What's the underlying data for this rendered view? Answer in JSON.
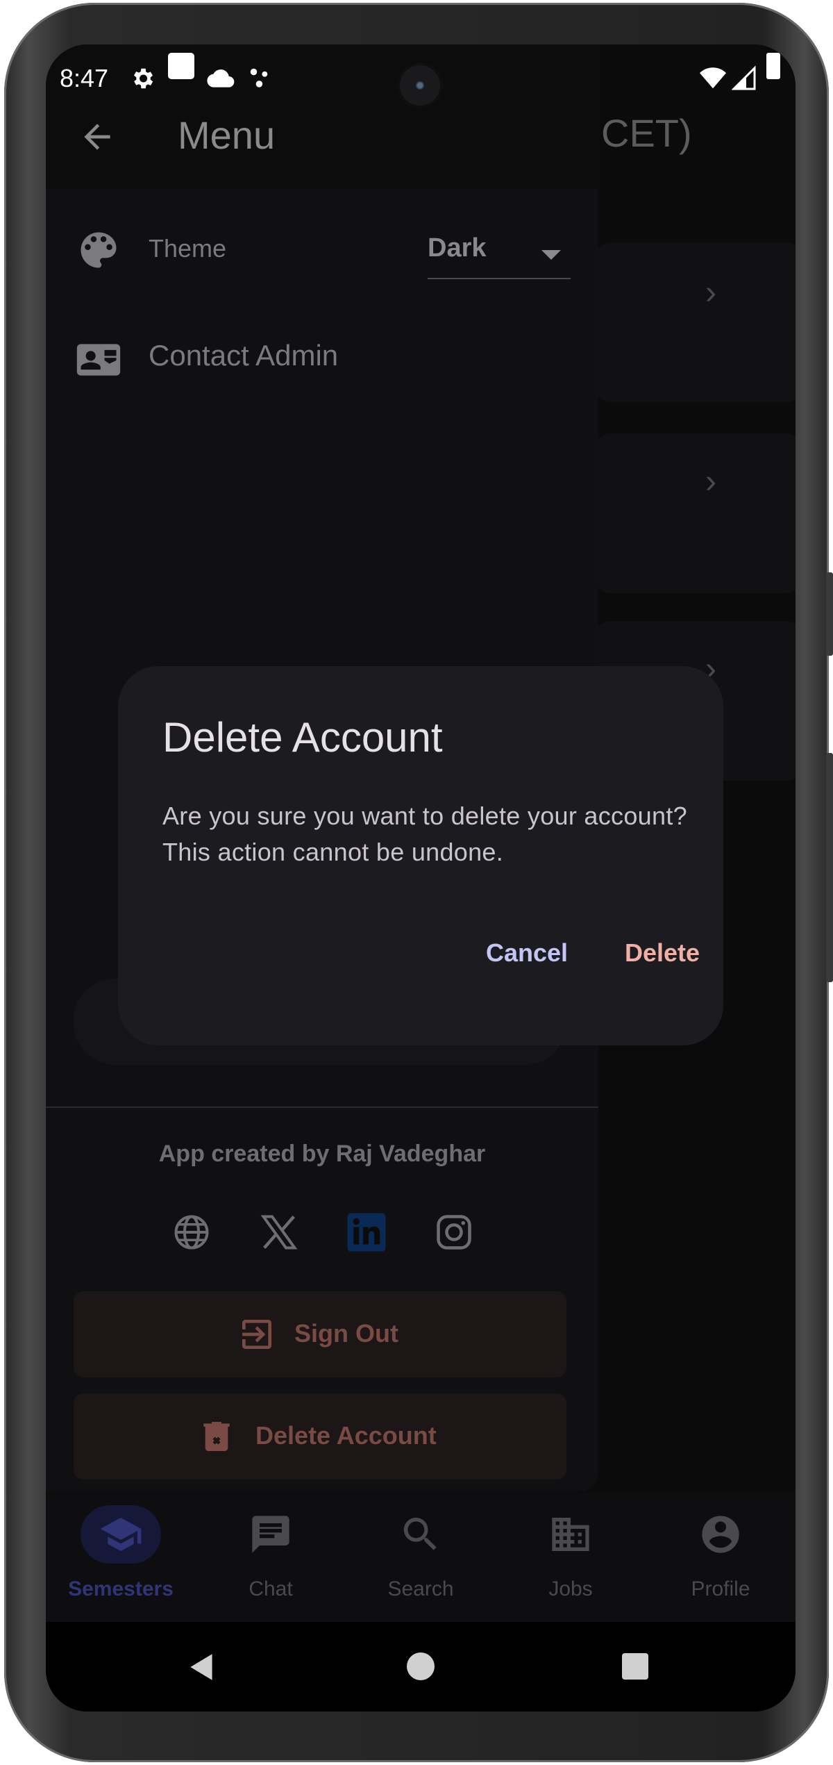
{
  "status_bar": {
    "time": "8:47",
    "icons": [
      "gear-icon",
      "square-notification-icon",
      "cloud-icon",
      "dots-icon",
      "wifi-icon",
      "signal-icon",
      "battery-icon"
    ]
  },
  "background_page": {
    "title_fragment": "CET)"
  },
  "drawer": {
    "title": "Menu",
    "theme_label": "Theme",
    "theme_value": "Dark",
    "contact_label": "Contact Admin",
    "credit": "App created by Raj Vadeghar",
    "social_icons": [
      "globe-icon",
      "x-icon",
      "linkedin-icon",
      "instagram-icon"
    ],
    "sign_out_label": "Sign Out",
    "delete_account_label": "Delete Account"
  },
  "bottom_nav": {
    "items": [
      {
        "label": "Semesters",
        "icon": "school-icon",
        "active": true
      },
      {
        "label": "Chat",
        "icon": "chat-icon",
        "active": false
      },
      {
        "label": "Search",
        "icon": "search-icon",
        "active": false
      },
      {
        "label": "Jobs",
        "icon": "business-icon",
        "active": false
      },
      {
        "label": "Profile",
        "icon": "profile-icon",
        "active": false
      }
    ]
  },
  "dialog": {
    "title": "Delete Account",
    "message": "Are you sure you want to delete your account? This action cannot be undone.",
    "cancel_label": "Cancel",
    "delete_label": "Delete"
  },
  "colors": {
    "dialog_surface": "#1b1b20",
    "cancel_text": "#c4c5f5",
    "delete_text": "#f0b0a4",
    "active_nav": "#2f3577"
  }
}
